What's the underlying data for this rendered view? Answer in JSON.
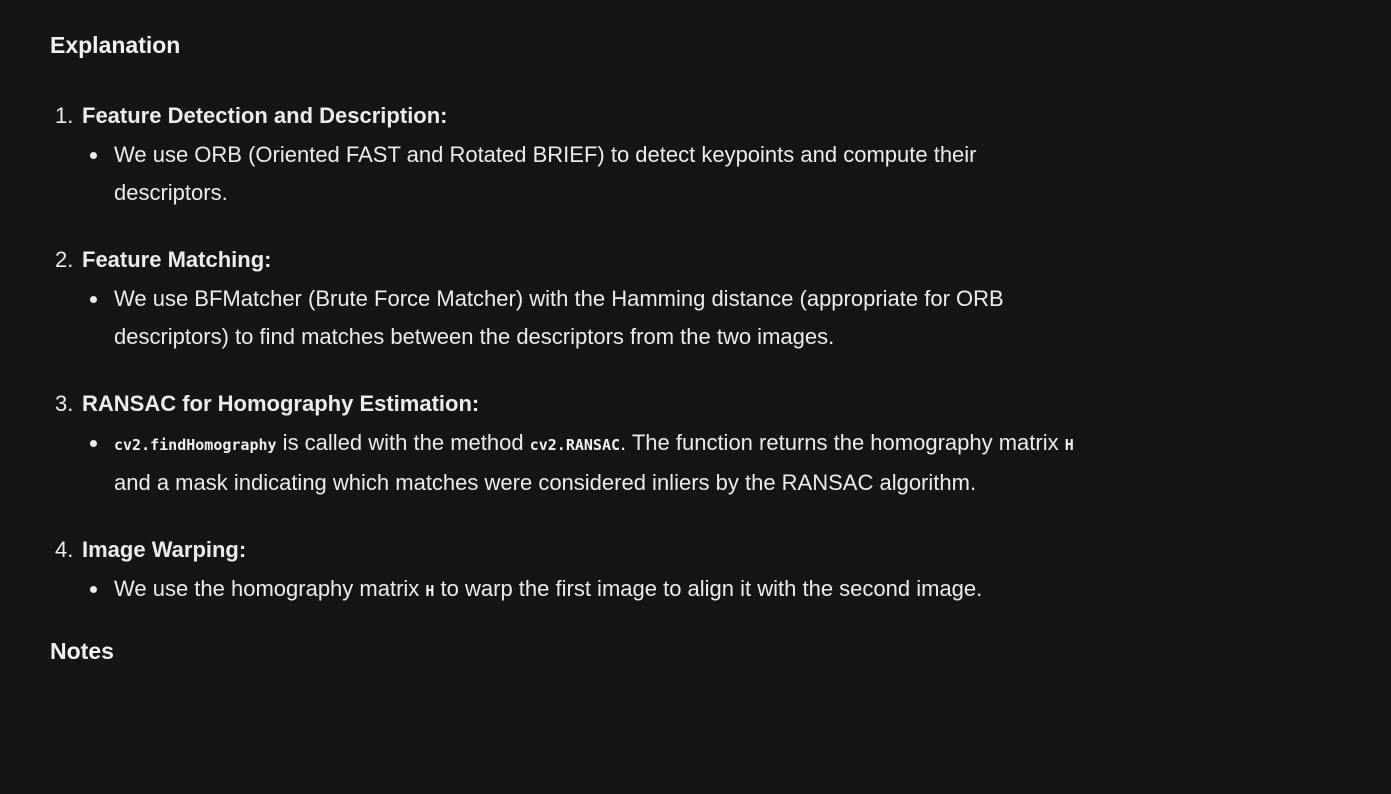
{
  "explanation_heading": "Explanation",
  "steps": [
    {
      "number": "1.",
      "title": "Feature Detection and Description:",
      "point": "We use ORB (Oriented FAST and Rotated BRIEF) to detect keypoints and compute their descriptors."
    },
    {
      "number": "2.",
      "title": "Feature Matching:",
      "point": "We use BFMatcher (Brute Force Matcher) with the Hamming distance (appropriate for ORB descriptors) to find matches between the descriptors from the two images."
    },
    {
      "number": "3.",
      "title": "RANSAC for Homography Estimation:",
      "point_code_1": "cv2.findHomography",
      "point_text_1": " is called with the method ",
      "point_code_2": "cv2.RANSAC",
      "point_text_2": ". The function returns the homography matrix ",
      "point_code_3": "H",
      "point_text_3": " and a mask indicating which matches were considered inliers by the RANSAC algorithm."
    },
    {
      "number": "4.",
      "title": "Image Warping:",
      "point_text_1": "We use the homography matrix ",
      "point_code_1": "H",
      "point_text_2": " to warp the first image to align it with the second image."
    }
  ],
  "notes_heading": "Notes"
}
